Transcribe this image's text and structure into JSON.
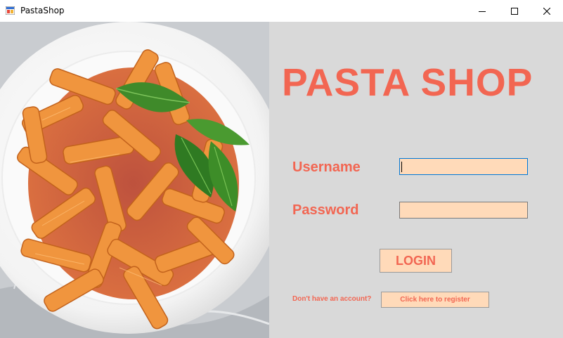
{
  "window": {
    "title": "PastaShop",
    "controls": {
      "minimize": "minimize-icon",
      "maximize": "maximize-icon",
      "close": "close-icon"
    }
  },
  "photo": {
    "subject": "pasta-dish-image"
  },
  "form": {
    "brand_title": "PASTA SHOP",
    "username_label": "Username",
    "username_value": "",
    "password_label": "Password",
    "password_value": "",
    "login_label": "LOGIN",
    "register_prompt": "Don't have an account?",
    "register_label": "Click here to register"
  },
  "colors": {
    "accent": "#f26652",
    "input_bg": "#ffdab9",
    "panel_bg": "#d9d9d9",
    "focus_border": "#0078d7"
  }
}
